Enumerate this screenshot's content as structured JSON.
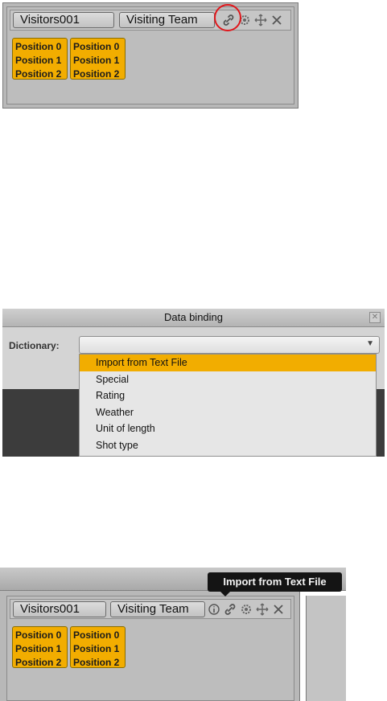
{
  "panel1": {
    "name_pill": "Visitors001",
    "team_pill": "Visiting Team",
    "icons": [
      "link-icon",
      "gear-icon",
      "move-icon",
      "close-icon"
    ],
    "chips": [
      [
        "Position 0",
        "Position 1",
        "Position 2"
      ],
      [
        "Position 0",
        "Position 1",
        "Position 2"
      ]
    ],
    "highlight_color": "#e0161b"
  },
  "panel2": {
    "dialog_title": "Data binding",
    "dictionary_label": "Dictionary:",
    "selected_value": "",
    "options": [
      "Import from Text File",
      "Special",
      "Rating",
      "Weather",
      "Unit of length",
      "Shot type"
    ],
    "highlighted_option": "Import from Text File",
    "accent_color": "#f2ad00"
  },
  "panel3": {
    "tooltip": "Import from Text File",
    "name_pill": "Visitors001",
    "team_pill": "Visiting Team",
    "icons": [
      "info-icon",
      "link-icon",
      "gear-icon",
      "move-icon",
      "close-icon"
    ],
    "chips": [
      [
        "Position 0",
        "Position 1",
        "Position 2"
      ],
      [
        "Position 0",
        "Position 1",
        "Position 2"
      ]
    ]
  }
}
